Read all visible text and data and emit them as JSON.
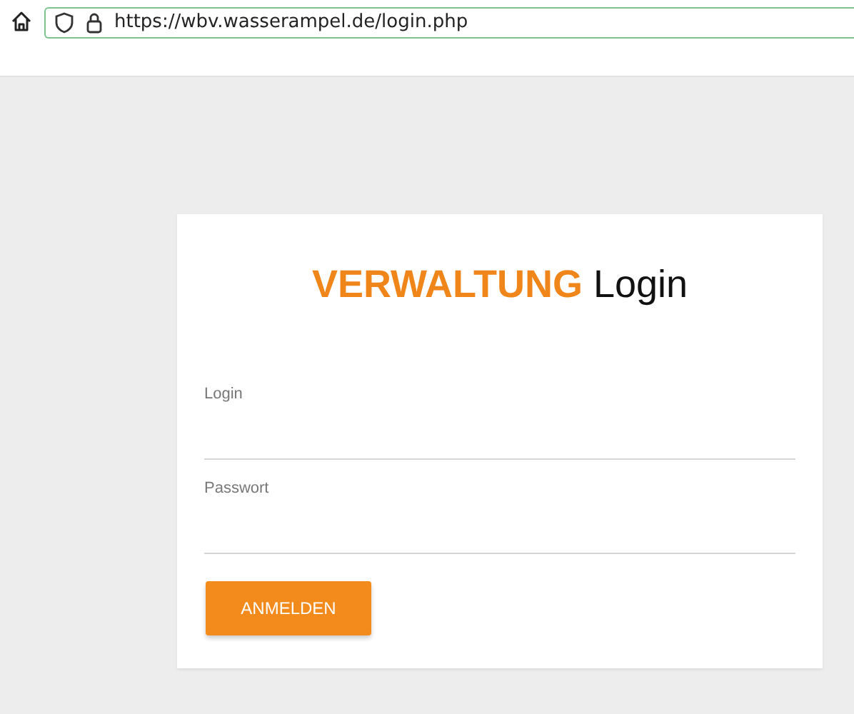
{
  "browser": {
    "url": "https://wbv.wasserampel.de/login.php"
  },
  "login_card": {
    "title": {
      "brand": "VERWALTUNG",
      "text": "Login"
    },
    "fields": [
      {
        "label": "Login"
      },
      {
        "label": "Passwort"
      }
    ],
    "submit_button": "ANMELDEN"
  }
}
